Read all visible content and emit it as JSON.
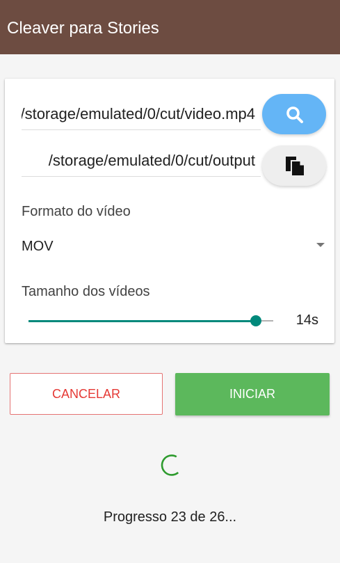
{
  "app": {
    "title": "Cleaver para Stories",
    "colors": {
      "app_bar": "#6d4c41",
      "accent_blue": "#64b5f6",
      "teal": "#00897b",
      "cancel_red": "#e53935",
      "start_green": "#5cb85c",
      "spinner_green": "#2e9b2e"
    }
  },
  "files": {
    "input_path": "/storage/emulated/0/cut/video.mp4",
    "output_path": "/storage/emulated/0/cut/output",
    "search_icon": "search-icon",
    "copy_icon": "copy-icon"
  },
  "format": {
    "label": "Formato do vídeo",
    "selected": "MOV",
    "dropdown_icon": "dropdown-arrow-icon"
  },
  "video_size": {
    "label": "Tamanho dos vídeos",
    "value_label": "14s",
    "slider_fraction": 0.93
  },
  "actions": {
    "cancel_label": "CANCELAR",
    "start_label": "INICIAR"
  },
  "progress": {
    "text": "Progresso 23 de 26..."
  }
}
